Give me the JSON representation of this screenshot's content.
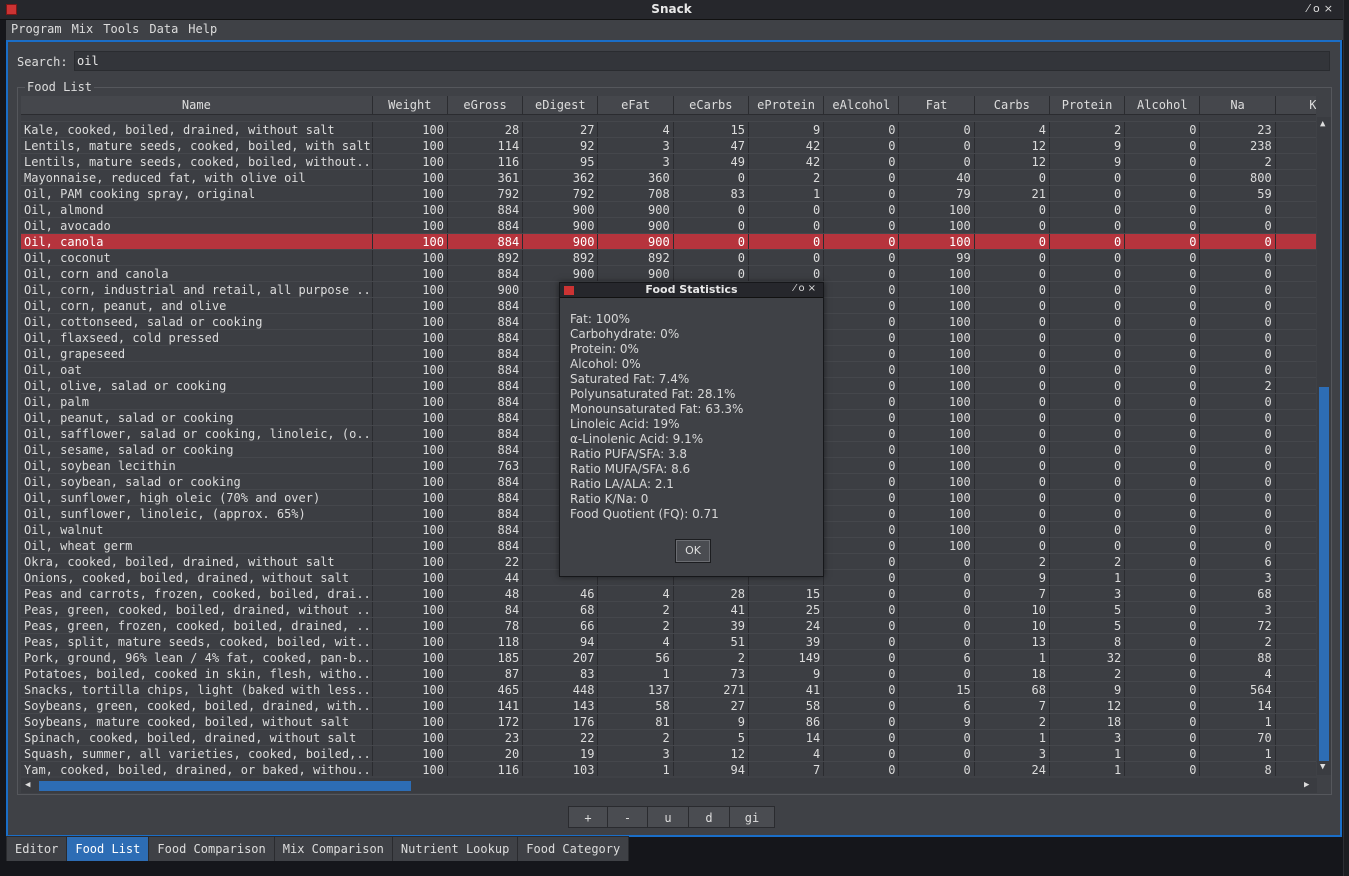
{
  "window": {
    "title": "Snack"
  },
  "menu": [
    "Program",
    "Mix",
    "Tools",
    "Data",
    "Help"
  ],
  "search": {
    "label": "Search:",
    "value": "oil"
  },
  "food_list": {
    "label": "Food List",
    "columns": [
      "Name",
      "Weight",
      "eGross",
      "eDigest",
      "eFat",
      "eCarbs",
      "eProtein",
      "eAlcohol",
      "Fat",
      "Carbs",
      "Protein",
      "Alcohol",
      "Na",
      "K"
    ],
    "selected_index": 7,
    "rows": [
      [
        "Kale, cooked, boiled, drained, without salt",
        "100",
        "28",
        "27",
        "4",
        "15",
        "9",
        "0",
        "0",
        "4",
        "2",
        "0",
        "23"
      ],
      [
        "Lentils, mature seeds, cooked, boiled, with salt",
        "100",
        "114",
        "92",
        "3",
        "47",
        "42",
        "0",
        "0",
        "12",
        "9",
        "0",
        "238"
      ],
      [
        "Lentils, mature seeds, cooked, boiled, without...",
        "100",
        "116",
        "95",
        "3",
        "49",
        "42",
        "0",
        "0",
        "12",
        "9",
        "0",
        "2"
      ],
      [
        "Mayonnaise, reduced fat, with olive oil",
        "100",
        "361",
        "362",
        "360",
        "0",
        "2",
        "0",
        "40",
        "0",
        "0",
        "0",
        "800"
      ],
      [
        "Oil, PAM cooking spray, original",
        "100",
        "792",
        "792",
        "708",
        "83",
        "1",
        "0",
        "79",
        "21",
        "0",
        "0",
        "59"
      ],
      [
        "Oil, almond",
        "100",
        "884",
        "900",
        "900",
        "0",
        "0",
        "0",
        "100",
        "0",
        "0",
        "0",
        "0"
      ],
      [
        "Oil, avocado",
        "100",
        "884",
        "900",
        "900",
        "0",
        "0",
        "0",
        "100",
        "0",
        "0",
        "0",
        "0"
      ],
      [
        "Oil, canola",
        "100",
        "884",
        "900",
        "900",
        "0",
        "0",
        "0",
        "100",
        "0",
        "0",
        "0",
        "0"
      ],
      [
        "Oil, coconut",
        "100",
        "892",
        "892",
        "892",
        "0",
        "0",
        "0",
        "99",
        "0",
        "0",
        "0",
        "0"
      ],
      [
        "Oil, corn and canola",
        "100",
        "884",
        "900",
        "900",
        "0",
        "0",
        "0",
        "100",
        "0",
        "0",
        "0",
        "0"
      ],
      [
        "Oil, corn, industrial and retail, all purpose ...",
        "100",
        "900",
        "",
        "",
        "",
        "",
        "0",
        "100",
        "0",
        "0",
        "0",
        "0"
      ],
      [
        "Oil, corn, peanut, and olive",
        "100",
        "884",
        "",
        "",
        "",
        "",
        "0",
        "100",
        "0",
        "0",
        "0",
        "0"
      ],
      [
        "Oil, cottonseed, salad or cooking",
        "100",
        "884",
        "",
        "",
        "",
        "",
        "0",
        "100",
        "0",
        "0",
        "0",
        "0"
      ],
      [
        "Oil, flaxseed, cold pressed",
        "100",
        "884",
        "",
        "",
        "",
        "",
        "0",
        "100",
        "0",
        "0",
        "0",
        "0"
      ],
      [
        "Oil, grapeseed",
        "100",
        "884",
        "",
        "",
        "",
        "",
        "0",
        "100",
        "0",
        "0",
        "0",
        "0"
      ],
      [
        "Oil, oat",
        "100",
        "884",
        "",
        "",
        "",
        "",
        "0",
        "100",
        "0",
        "0",
        "0",
        "0"
      ],
      [
        "Oil, olive, salad or cooking",
        "100",
        "884",
        "",
        "",
        "",
        "",
        "0",
        "100",
        "0",
        "0",
        "0",
        "2"
      ],
      [
        "Oil, palm",
        "100",
        "884",
        "",
        "",
        "",
        "",
        "0",
        "100",
        "0",
        "0",
        "0",
        "0"
      ],
      [
        "Oil, peanut, salad or cooking",
        "100",
        "884",
        "",
        "",
        "",
        "",
        "0",
        "100",
        "0",
        "0",
        "0",
        "0"
      ],
      [
        "Oil, safflower, salad or cooking, linoleic, (o...",
        "100",
        "884",
        "",
        "",
        "",
        "",
        "0",
        "100",
        "0",
        "0",
        "0",
        "0"
      ],
      [
        "Oil, sesame, salad or cooking",
        "100",
        "884",
        "",
        "",
        "",
        "",
        "0",
        "100",
        "0",
        "0",
        "0",
        "0"
      ],
      [
        "Oil, soybean lecithin",
        "100",
        "763",
        "",
        "",
        "",
        "",
        "0",
        "100",
        "0",
        "0",
        "0",
        "0"
      ],
      [
        "Oil, soybean, salad or cooking",
        "100",
        "884",
        "",
        "",
        "",
        "",
        "0",
        "100",
        "0",
        "0",
        "0",
        "0"
      ],
      [
        "Oil, sunflower, high oleic (70% and over)",
        "100",
        "884",
        "",
        "",
        "",
        "",
        "0",
        "100",
        "0",
        "0",
        "0",
        "0"
      ],
      [
        "Oil, sunflower, linoleic, (approx. 65%)",
        "100",
        "884",
        "",
        "",
        "",
        "",
        "0",
        "100",
        "0",
        "0",
        "0",
        "0"
      ],
      [
        "Oil, walnut",
        "100",
        "884",
        "",
        "",
        "",
        "",
        "0",
        "100",
        "0",
        "0",
        "0",
        "0"
      ],
      [
        "Oil, wheat germ",
        "100",
        "884",
        "",
        "",
        "",
        "",
        "0",
        "100",
        "0",
        "0",
        "0",
        "0"
      ],
      [
        "Okra, cooked, boiled, drained, without salt",
        "100",
        "22",
        "",
        "",
        "",
        "",
        "0",
        "0",
        "2",
        "2",
        "0",
        "6"
      ],
      [
        "Onions, cooked, boiled, drained, without salt",
        "100",
        "44",
        "",
        "",
        "",
        "",
        "0",
        "0",
        "9",
        "1",
        "0",
        "3"
      ],
      [
        "Peas and carrots, frozen, cooked, boiled, drai...",
        "100",
        "48",
        "46",
        "4",
        "28",
        "15",
        "0",
        "0",
        "7",
        "3",
        "0",
        "68"
      ],
      [
        "Peas, green, cooked, boiled, drained, without ...",
        "100",
        "84",
        "68",
        "2",
        "41",
        "25",
        "0",
        "0",
        "10",
        "5",
        "0",
        "3"
      ],
      [
        "Peas, green, frozen, cooked, boiled, drained, ...",
        "100",
        "78",
        "66",
        "2",
        "39",
        "24",
        "0",
        "0",
        "10",
        "5",
        "0",
        "72"
      ],
      [
        "Peas, split, mature seeds, cooked, boiled, wit...",
        "100",
        "118",
        "94",
        "4",
        "51",
        "39",
        "0",
        "0",
        "13",
        "8",
        "0",
        "2"
      ],
      [
        "Pork, ground, 96% lean / 4% fat, cooked, pan-b...",
        "100",
        "185",
        "207",
        "56",
        "2",
        "149",
        "0",
        "6",
        "1",
        "32",
        "0",
        "88"
      ],
      [
        "Potatoes, boiled, cooked in skin, flesh, witho...",
        "100",
        "87",
        "83",
        "1",
        "73",
        "9",
        "0",
        "0",
        "18",
        "2",
        "0",
        "4"
      ],
      [
        "Snacks, tortilla chips, light (baked with less...",
        "100",
        "465",
        "448",
        "137",
        "271",
        "41",
        "0",
        "15",
        "68",
        "9",
        "0",
        "564"
      ],
      [
        "Soybeans, green, cooked, boiled, drained, with...",
        "100",
        "141",
        "143",
        "58",
        "27",
        "58",
        "0",
        "6",
        "7",
        "12",
        "0",
        "14"
      ],
      [
        "Soybeans, mature cooked, boiled, without salt",
        "100",
        "172",
        "176",
        "81",
        "9",
        "86",
        "0",
        "9",
        "2",
        "18",
        "0",
        "1"
      ],
      [
        "Spinach, cooked, boiled, drained, without salt",
        "100",
        "23",
        "22",
        "2",
        "5",
        "14",
        "0",
        "0",
        "1",
        "3",
        "0",
        "70"
      ],
      [
        "Squash, summer, all varieties, cooked, boiled,...",
        "100",
        "20",
        "19",
        "3",
        "12",
        "4",
        "0",
        "0",
        "3",
        "1",
        "0",
        "1"
      ],
      [
        "Yam, cooked, boiled, drained, or baked, withou...",
        "100",
        "116",
        "103",
        "1",
        "94",
        "7",
        "0",
        "0",
        "24",
        "1",
        "0",
        "8"
      ]
    ]
  },
  "buttons": [
    "+",
    "-",
    "u",
    "d",
    "gi"
  ],
  "tabs": [
    "Editor",
    "Food List",
    "Food Comparison",
    "Mix Comparison",
    "Nutrient Lookup",
    "Food Category"
  ],
  "active_tab": 1,
  "dialog": {
    "title": "Food Statistics",
    "lines": [
      "Fat: 100%",
      "Carbohydrate: 0%",
      "Protein: 0%",
      "Alcohol: 0%",
      "Saturated Fat: 7.4%",
      "Polyunsaturated Fat: 28.1%",
      "Monounsaturated Fat: 63.3%",
      "Linoleic Acid: 19%",
      "α-Linolenic Acid: 9.1%",
      "Ratio PUFA/SFA: 3.8",
      "Ratio MUFA/SFA: 8.6",
      "Ratio LA/ALA: 2.1",
      "Ratio K/Na: 0",
      "Food Quotient (FQ): 0.71"
    ],
    "ok_label": "OK"
  },
  "colors": {
    "accent": "#2d6db5",
    "selected_row": "#b6343d"
  }
}
